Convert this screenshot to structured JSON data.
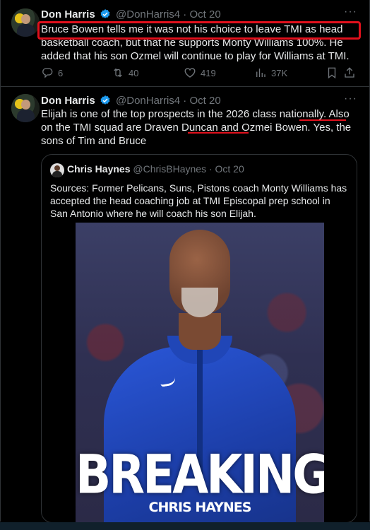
{
  "tweet1": {
    "name": "Don Harris",
    "handle": "@DonHarris4",
    "separator": "·",
    "date": "Oct 20",
    "more": "···",
    "text": "Bruce Bowen tells me it was not his choice to leave TMI as head basketball coach, but that he supports Monty Williams 100%. He added that his son Ozmel will continue to play for Williams at TMI.",
    "actions": {
      "replies": "6",
      "reposts": "40",
      "likes": "419",
      "views": "37K"
    }
  },
  "tweet2": {
    "name": "Don Harris",
    "handle": "@DonHarris4",
    "separator": "·",
    "date": "Oct 20",
    "more": "···",
    "text": "Elijah is one of the top prospects in the 2026 class nationally. Also on the TMI squad are Draven Duncan and Ozmei Bowen. Yes, the sons of Tim and Bruce",
    "quote": {
      "name": "Chris Haynes",
      "handle": "@ChrisBHaynes",
      "separator": "·",
      "date": "Oct 20",
      "text": "Sources: Former Pelicans, Suns, Pistons coach Monty Williams has accepted the head coaching job at TMI Episcopal prep school in San Antonio where he will coach his son Elijah.",
      "image_headline": "BREAKING",
      "image_byline": "CHRIS HAYNES"
    }
  },
  "colors": {
    "background": "#000000",
    "text": "#e7e9ea",
    "muted": "#71767b",
    "verified": "#1d9bf0",
    "annotation": "#e0101c"
  },
  "icons": [
    "verified-badge-icon",
    "more-icon",
    "reply-icon",
    "repost-icon",
    "like-icon",
    "views-icon",
    "bookmark-icon",
    "share-icon"
  ]
}
